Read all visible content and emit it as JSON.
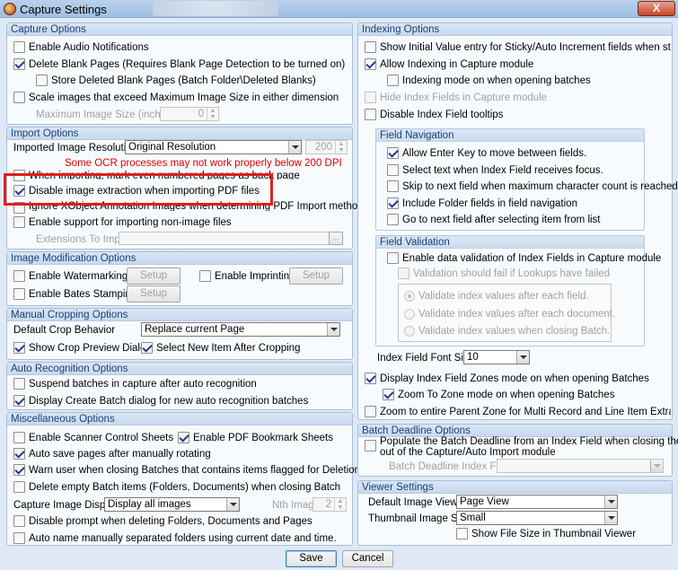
{
  "window": {
    "title": "Capture Settings",
    "close_label": "X"
  },
  "capture_options": {
    "header": "Capture Options",
    "audio": {
      "label": "Enable Audio Notifications",
      "checked": false
    },
    "delete_blank": {
      "label": "Delete Blank Pages (Requires Blank Page Detection to be turned on)",
      "checked": true
    },
    "store_deleted": {
      "label": "Store Deleted Blank Pages (Batch Folder\\Deleted Blanks)",
      "checked": false
    },
    "scale_images": {
      "label": "Scale images that exceed Maximum Image Size in either dimension",
      "checked": false
    },
    "max_size_label": "Maximum Image Size (inches)",
    "max_size_value": "0"
  },
  "import_options": {
    "header": "Import Options",
    "resolution_label": "Imported Image Resolution",
    "resolution_value": "Original Resolution",
    "dpi_value": "200",
    "ocr_warning": "Some OCR processes may not work properly below 200 DPI",
    "even_pages": {
      "label": "When importing, mark even numbered pages as back page",
      "checked": false
    },
    "disable_extraction": {
      "label": "Disable image extraction when importing PDF files",
      "checked": true
    },
    "ignore_xobject": {
      "label": "Ignore XObject Annotation Images when determining PDF Import method",
      "checked": false
    },
    "non_image": {
      "label": "Enable support for importing non-image files",
      "checked": false
    },
    "extensions_label": "Extensions To Import",
    "extensions_button": "..."
  },
  "image_modification": {
    "header": "Image Modification Options",
    "watermarking": {
      "label": "Enable Watermarking",
      "checked": false
    },
    "imprinting": {
      "label": "Enable Imprinting",
      "checked": false
    },
    "bates": {
      "label": "Enable Bates Stamping",
      "checked": false
    },
    "setup_label": "Setup"
  },
  "manual_cropping": {
    "header": "Manual Cropping Options",
    "crop_behavior_label": "Default Crop Behavior",
    "crop_behavior_value": "Replace current Page",
    "show_preview": {
      "label": "Show Crop Preview Dialog",
      "checked": true
    },
    "select_new": {
      "label": "Select New Item After Cropping",
      "checked": true
    }
  },
  "auto_recognition": {
    "header": "Auto Recognition Options",
    "suspend": {
      "label": "Suspend batches in capture after auto recognition",
      "checked": false
    },
    "display_create": {
      "label": "Display Create Batch dialog for new auto recognition batches",
      "checked": true
    }
  },
  "misc": {
    "header": "Miscellaneous Options",
    "scanner_sheets": {
      "label": "Enable Scanner Control Sheets",
      "checked": false
    },
    "pdf_bookmark": {
      "label": "Enable PDF Bookmark Sheets",
      "checked": true
    },
    "auto_save": {
      "label": "Auto save pages after manually rotating",
      "checked": true
    },
    "warn_user": {
      "label": "Warn user when closing Batches that contains items flagged for Deletion or Rejection",
      "checked": true
    },
    "delete_empty": {
      "label": "Delete empty Batch items (Folders, Documents) when closing Batch",
      "checked": false
    },
    "capture_display_label": "Capture Image Display",
    "capture_display_value": "Display all images",
    "nth_label": "Nth Image",
    "nth_value": "2",
    "disable_prompt": {
      "label": "Disable prompt when deleting Folders, Documents and Pages",
      "checked": false
    },
    "auto_name": {
      "label": "Auto name manually separated folders using current date and time.",
      "checked": false
    }
  },
  "indexing": {
    "header": "Indexing Options",
    "show_initial": {
      "label": "Show Initial Value entry for Sticky/Auto Increment fields when starting capture",
      "checked": false
    },
    "allow_indexing": {
      "label": "Allow Indexing in Capture module",
      "checked": true
    },
    "indexing_mode": {
      "label": "Indexing mode on when opening batches",
      "checked": false
    },
    "hide_index": {
      "label": "Hide Index Fields in Capture module",
      "checked": false
    },
    "disable_tooltips": {
      "label": "Disable Index Field tooltips",
      "checked": false
    },
    "field_navigation": {
      "header": "Field Navigation",
      "enter_key": {
        "label": "Allow Enter Key to move between fields.",
        "checked": true
      },
      "select_text": {
        "label": "Select text when Index Field receives focus.",
        "checked": false
      },
      "skip_next": {
        "label": "Skip to next field when maximum character count is reached.",
        "checked": false
      },
      "include_folder": {
        "label": "Include Folder fields in field navigation",
        "checked": true
      },
      "go_next": {
        "label": "Go to next field after selecting item from list",
        "checked": false
      }
    },
    "field_validation": {
      "header": "Field Validation",
      "enable_validation": {
        "label": "Enable data validation of Index Fields in Capture module",
        "checked": false
      },
      "lookups_fail": {
        "label": "Validation should fail if Lookups have failed",
        "checked": false
      },
      "radio_each_field": {
        "label": "Validate index values after each field.",
        "selected": true
      },
      "radio_each_document": {
        "label": "Validate index values after each document.",
        "selected": false
      },
      "radio_closing_batch": {
        "label": "Validate index values when closing Batch.",
        "selected": false
      }
    },
    "font_size_label": "Index Field Font Size",
    "font_size_value": "10",
    "display_zones": {
      "label": "Display Index Field Zones mode on when opening Batches",
      "checked": true
    },
    "zoom_to_zone": {
      "label": "Zoom To Zone mode on when opening Batches",
      "checked": true
    },
    "zoom_parent": {
      "label": "Zoom to entire Parent Zone for Multi Record and Line Item Extraction Zones",
      "checked": false
    }
  },
  "batch_deadline": {
    "header": "Batch Deadline Options",
    "populate": {
      "label_line1": "Populate the Batch Deadline from an Index Field when closing the Batch",
      "label_line2": "out of the Capture/Auto Import module",
      "checked": false
    },
    "index_field_label": "Batch Deadline Index Field"
  },
  "viewer": {
    "header": "Viewer Settings",
    "default_view_label": "Default Image View",
    "default_view_value": "Page View",
    "thumbnail_size_label": "Thumbnail Image Size",
    "thumbnail_size_value": "Small",
    "show_file_size": {
      "label": "Show File Size in Thumbnail Viewer",
      "checked": false
    }
  },
  "footer": {
    "save_label": "Save",
    "cancel_label": "Cancel"
  },
  "colors": {
    "header_text": "#1e3d7a",
    "panel_border": "#a8bed6",
    "warning_text": "#e00000",
    "highlight_box": "#e01e1e"
  }
}
